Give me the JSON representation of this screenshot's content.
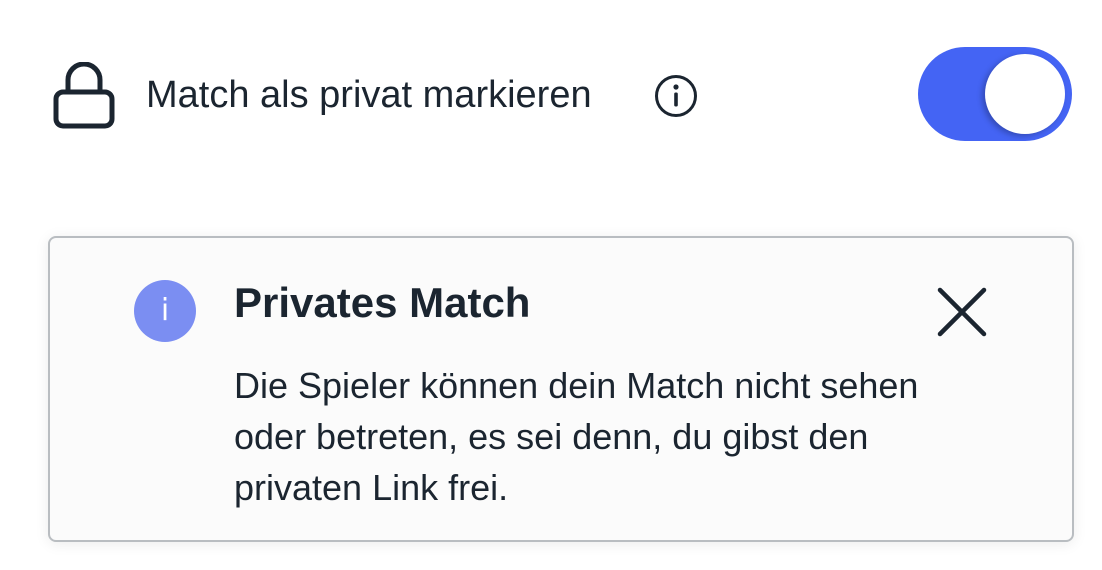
{
  "setting": {
    "label": "Match als privat markieren",
    "lock_icon": "lock-icon",
    "info_icon": "info-outline-icon",
    "toggle_on": true,
    "toggle_color": "#4464f4"
  },
  "info_card": {
    "badge_icon": "info-icon",
    "badge_glyph": "i",
    "badge_color": "#7b8ef2",
    "title": "Privates Match",
    "body": "Die Spieler können dein Match nicht sehen oder betreten, es sei denn, du gibst den privaten Link frei.",
    "close_icon": "close-icon"
  }
}
